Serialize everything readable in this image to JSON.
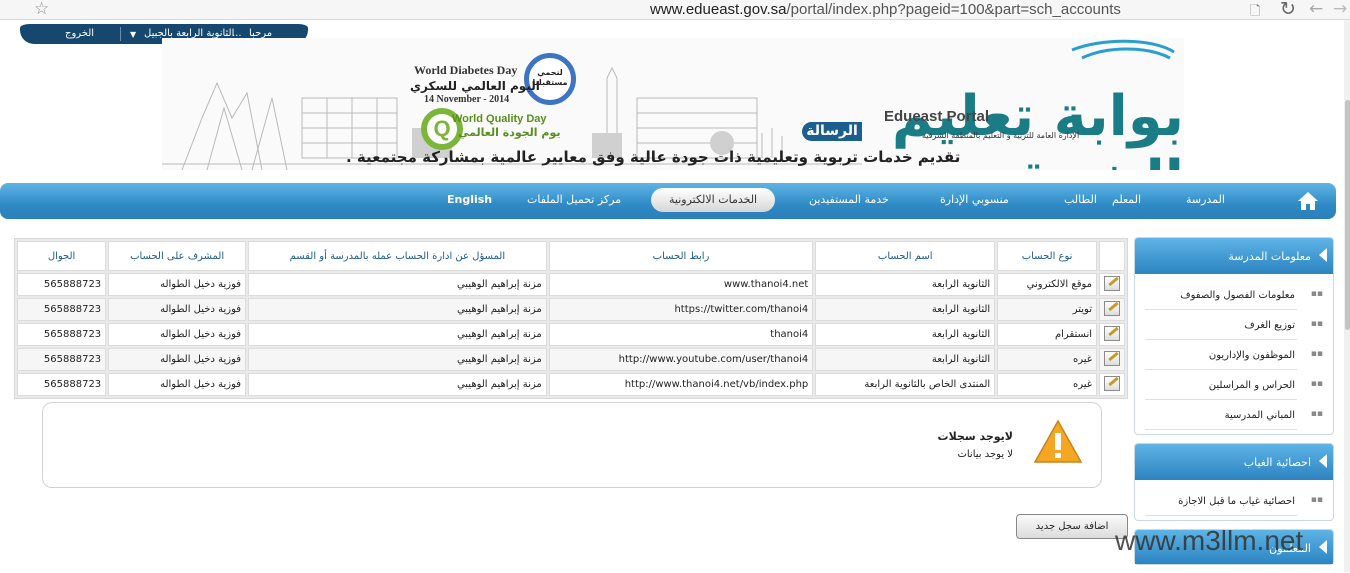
{
  "browser": {
    "url_host": "www.edueast.gov.sa",
    "url_path": "/portal/index.php?pageid=100&part=sch_accounts"
  },
  "userbar": {
    "welcome": "مرحبا",
    "dots": "...",
    "school": "الثانوية الرابعة بالجبيل",
    "logout": "الخروج"
  },
  "banner": {
    "portal_title": "تعليم الشرقية",
    "portal_prefix": "بوابة",
    "portal_en": "Edueast Portal",
    "risala": "الرسالة",
    "gov_line": "الإدارة العامة للتربية و التعليم بالمنطقة الشرقية",
    "tagline": "تقديم خدمات تربوية وتعليمية ذات جودة عالية وفق معايير عالمية بمشاركة مجتمعية .",
    "wdd_en": "World Diabetes Day",
    "wdd_ar": "اليوم العالمي للسكري",
    "wdd_date": "14 November - 2014",
    "circle_text": "لنحمي مستقبلنا",
    "wqd_en": "World Quality Day",
    "wqd_ar": "يوم الجودة العالمي"
  },
  "nav": {
    "items": [
      "المدرسة",
      "المعلم",
      "الطالب",
      "منسوبي الإدارة",
      "خدمة المستفيدين",
      "الخدمات الالكترونية",
      "مركز تحميل الملفات",
      "English"
    ],
    "active": "الخدمات الالكترونية"
  },
  "sidebar": {
    "school_info": {
      "title": "معلومات المدرسة",
      "items": [
        "معلومات الفصول والصفوف",
        "توزيع الغرف",
        "الموظفون والإداريون",
        "الحراس و المراسلين",
        "المباني المدرسية"
      ]
    },
    "absence": {
      "title": "احصائية الغياب",
      "items": [
        "احصائية غياب ما قبل الاجازة"
      ]
    },
    "third": {
      "title": "المعلمون"
    }
  },
  "table": {
    "headers": [
      "نوع الحساب",
      "اسم الحساب",
      "رابط الحساب",
      "المسؤل عن ادارة الحساب عمله بالمدرسة أو القسم",
      "المشرف على الحساب",
      "الجوال"
    ],
    "rows": [
      [
        "موقع الالكتروني",
        "الثانوية الرابعة",
        "www.thanoi4.net",
        "مزنة إبراهيم الوهيبي",
        "فوزية دخيل الطواله",
        "565888723"
      ],
      [
        "تويتر",
        "الثانوية الرابعة",
        "https://twitter.com/thanoi4",
        "مزنة إبراهيم الوهيبي",
        "فوزية دخيل الطواله",
        "565888723"
      ],
      [
        "انستقرام",
        "الثانوية الرابعة",
        "thanoi4",
        "مزنة إبراهيم الوهيبي",
        "فوزية دخيل الطواله",
        "565888723"
      ],
      [
        "غيره",
        "الثانوية الرابعة",
        "http://www.youtube.com/user/thanoi4",
        "مزنة إبراهيم الوهيبي",
        "فوزية دخيل الطواله",
        "565888723"
      ],
      [
        "غيره",
        "المنتدى الخاص بالثانوية الرابعة",
        "http://www.thanoi4.net/vb/index.php",
        "مزنة إبراهيم الوهيبي",
        "فوزية دخيل الطواله",
        "565888723"
      ]
    ]
  },
  "notice": {
    "title": "لايوجد سجلات",
    "subtitle": "لا يوجد بيانات"
  },
  "add_button": "اضافة سجل جديد",
  "watermark": "www.m3llm.net",
  "icons": {
    "bookmark": "star-icon",
    "reload": "reload-icon",
    "back": "back-arrow-icon",
    "forward": "forward-arrow-icon",
    "home": "home-icon",
    "edit": "edit-icon",
    "warning": "warning-icon",
    "bullet": "bullet-icon"
  },
  "colors": {
    "nav_blue": "#2f8ac5",
    "userbar": "#15476f",
    "header_text": "#1d5a8c",
    "warning": "#f0a020"
  }
}
